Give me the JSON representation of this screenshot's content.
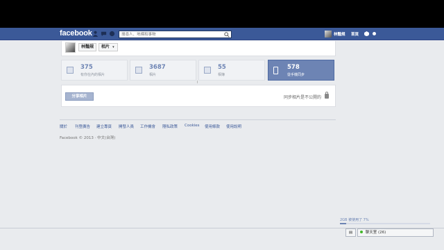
{
  "topbar": {
    "logo": "facebook",
    "search_placeholder": "搜尋人、地標和事物",
    "user_name": "林豔規",
    "home_label": "首頁"
  },
  "header": {
    "user_name": "林豔規",
    "section": "相片"
  },
  "stats": [
    {
      "number": "375",
      "label": "有你在內的相片",
      "icon": "tagged-photos-icon",
      "active": false
    },
    {
      "number": "3687",
      "label": "相片",
      "icon": "photos-icon",
      "active": false
    },
    {
      "number": "55",
      "label": "相簿",
      "icon": "albums-icon",
      "active": false
    },
    {
      "number": "578",
      "label": "從手機同步",
      "icon": "phone-sync-icon",
      "active": true
    }
  ],
  "sync": {
    "share_button": "分享相片",
    "privacy_note": "同步相片是不公開的"
  },
  "footer": {
    "links": [
      "關於",
      "刊登廣告",
      "建立專頁",
      "開發人員",
      "工作機會",
      "隱私政策",
      "Cookies",
      "使用條款",
      "使用說明"
    ],
    "copyright": "Facebook © 2013 · 中文(台灣)"
  },
  "storage": {
    "text": "2GB 被使用了 7%",
    "used_fraction": 0.07
  },
  "chat": {
    "label": "聊天室 (26)"
  },
  "colors": {
    "brand": "#3b5998",
    "accent": "#6d84b4"
  }
}
